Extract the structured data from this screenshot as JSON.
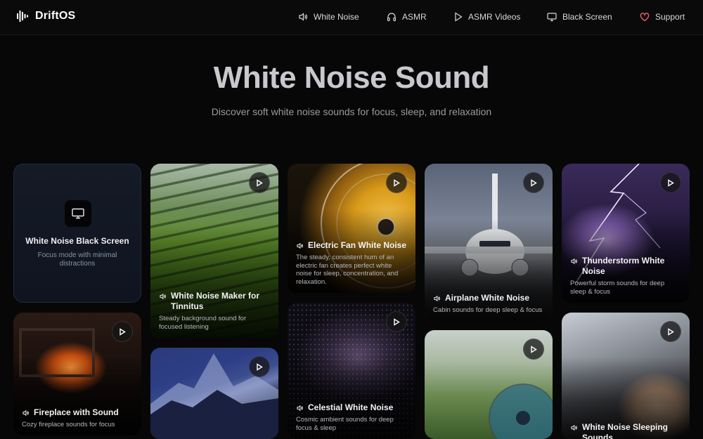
{
  "nav": {
    "brand": "DriftOS",
    "items": [
      {
        "label": "White Noise",
        "icon": "speaker-icon"
      },
      {
        "label": "ASMR",
        "icon": "headphones-icon"
      },
      {
        "label": "ASMR Videos",
        "icon": "play-icon"
      },
      {
        "label": "Black Screen",
        "icon": "monitor-icon"
      },
      {
        "label": "Support",
        "icon": "heart-icon"
      }
    ]
  },
  "hero": {
    "title": "White Noise Sound",
    "subtitle": "Discover soft white noise sounds for focus, sleep, and relaxation"
  },
  "cards": [
    {
      "title": "White Noise Black Screen",
      "desc": "Focus mode with minimal distractions",
      "icon": "monitor-icon"
    },
    {
      "title": "Fireplace with Sound",
      "desc": "Cozy fireplace sounds for focus"
    },
    {
      "title": "White Noise Maker for Tinnitus",
      "desc": "Steady background sound for focused listening"
    },
    {
      "title": "",
      "desc": ""
    },
    {
      "title": "Electric Fan White Noise",
      "desc": "The steady, consistent hum of an electric fan creates perfect white noise for sleep, concentration, and relaxation."
    },
    {
      "title": "Celestial White Noise",
      "desc": "Cosmic ambient sounds for deep focus & sleep"
    },
    {
      "title": "Airplane White Noise",
      "desc": "Cabin sounds for deep sleep & focus"
    },
    {
      "title": "",
      "desc": ""
    },
    {
      "title": "Thunderstorm White Noise",
      "desc": "Powerful storm sounds for deep sleep & focus"
    },
    {
      "title": "White Noise Sleeping Sounds",
      "desc": ""
    }
  ],
  "colors": {
    "accent_heart": "#e05a6a",
    "background": "#070708"
  }
}
